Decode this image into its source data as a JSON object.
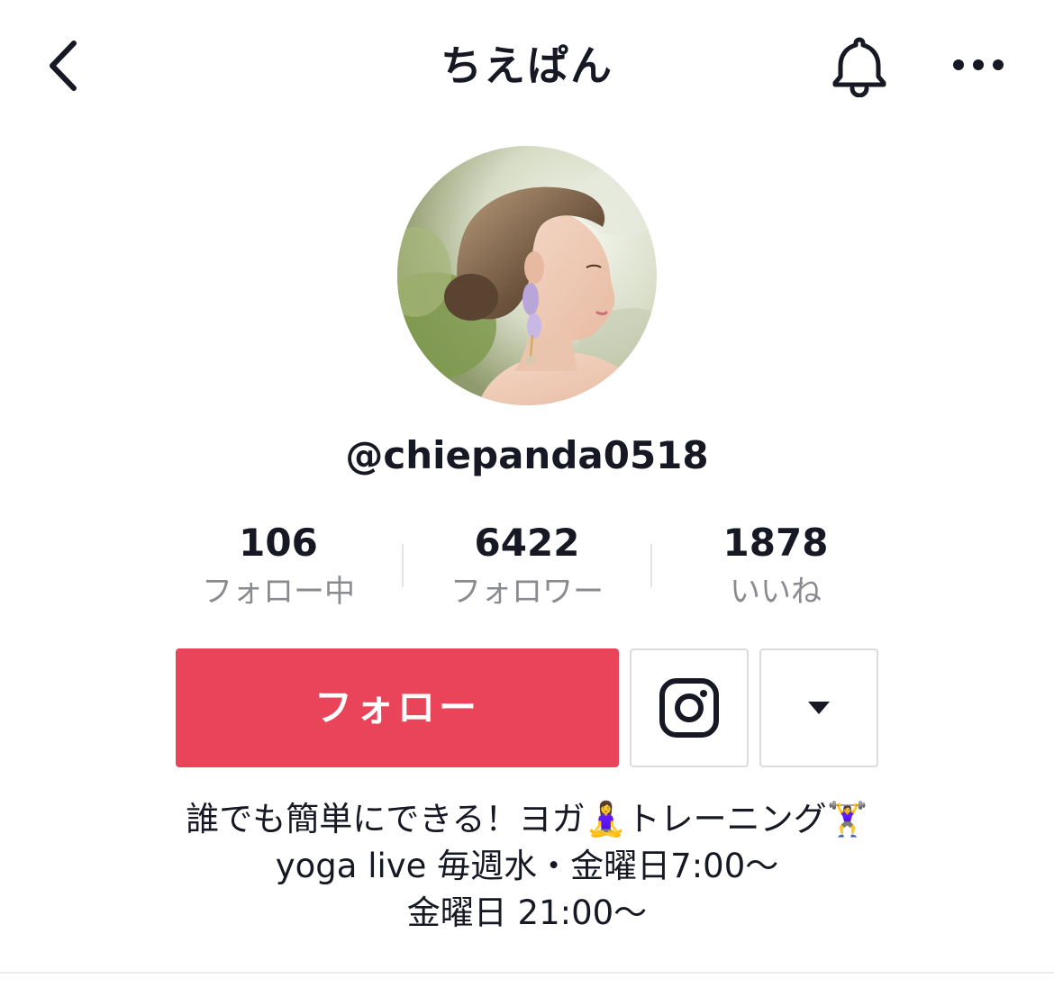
{
  "header": {
    "title": "ちえぱん",
    "back_icon": "chevron-left-icon",
    "bell_icon": "bell-icon",
    "more_icon": "more-horizontal-icon"
  },
  "profile": {
    "username": "@chiepanda0518",
    "avatar": "profile-photo"
  },
  "stats": [
    {
      "value": "106",
      "label": "フォロー中"
    },
    {
      "value": "6422",
      "label": "フォロワー"
    },
    {
      "value": "1878",
      "label": "いいね"
    }
  ],
  "actions": {
    "follow_label": "フォロー",
    "instagram_icon": "instagram-icon",
    "dropdown_icon": "caret-down-icon"
  },
  "bio": {
    "line1": "誰でも簡単にできる！ヨガ🧘‍♀️トレーニング🏋️‍♀️",
    "line2": "yoga live 毎週水・金曜日7:00〜",
    "line3": "金曜日 21:00〜"
  },
  "colors": {
    "accent": "#ea445a",
    "text": "#161823",
    "muted": "#8a8b91"
  }
}
